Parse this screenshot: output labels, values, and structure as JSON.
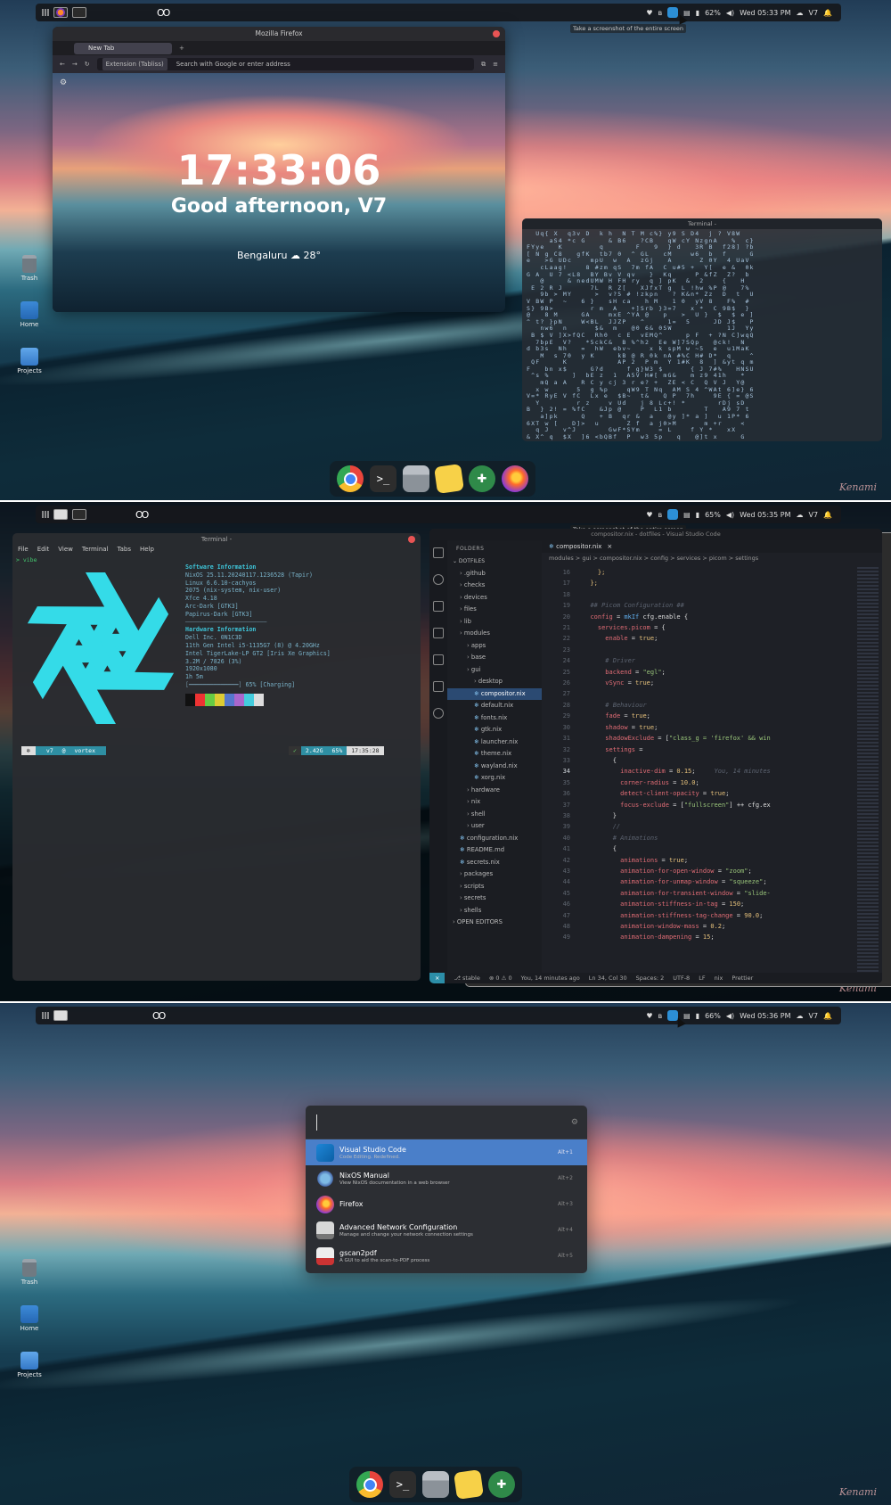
{
  "common": {
    "signature": "Kenami",
    "desktop_icons": [
      "Trash",
      "Home",
      "Projects"
    ],
    "ws_rings": "OO"
  },
  "panel1": {
    "topbar": {
      "battery": "62%",
      "datetime": "Wed 05:33 PM",
      "user": "V7",
      "tooltip": "Take a screenshot of the entire screen"
    },
    "firefox": {
      "window_title": "Mozilla Firefox",
      "tab_label": "New Tab",
      "extension_label": "Extension (Tabliss)",
      "url_placeholder": "Search with Google or enter address",
      "clock": "17:33:06",
      "greeting": "Good afternoon, V7",
      "weather_city": "Bengaluru",
      "weather_temp": "28°"
    },
    "matrix_terminal": {
      "title": "Terminal -"
    }
  },
  "panel2": {
    "topbar": {
      "battery": "65%",
      "datetime": "Wed 05:35 PM",
      "user": "V7",
      "tooltip": "Take a screenshot of the entire screen"
    },
    "terminal": {
      "title": "Terminal -",
      "menu": [
        "File",
        "Edit",
        "View",
        "Terminal",
        "Tabs",
        "Help"
      ],
      "prompt": "> vibe",
      "sw_header": "Software Information",
      "sw_lines": [
        "NixOS 25.11.20240117.1236528 (Tapir)",
        "Linux 6.6.10-cachyos",
        "2075 (nix-system, nix-user)",
        "Xfce 4.18",
        "Arc-Dark [GTK3]",
        "Papirus-Dark [GTK3]"
      ],
      "hw_header": "Hardware Information",
      "hw_lines": [
        "Dell Inc. 0N1C3D",
        "11th Gen Intel i5-1135G7 (8) @ 4.20GHz",
        "Intel TigerLake-LP GT2 [Iris Xe Graphics]",
        "3.2M / 7826 (3%)",
        "1920x1080",
        "1h 5m"
      ],
      "battery_line": "65% [Charging]",
      "pl_user": "v7",
      "pl_host": "vortex",
      "pl_mem": "2.42G",
      "pl_bat": "65%",
      "pl_time": "17:35:28"
    },
    "vscode": {
      "window_title": "compositor.nix - dotfiles - Visual Studio Code",
      "explorer_header": "FOLDERS",
      "root": "DOTFILES",
      "tree": [
        ".github",
        "checks",
        "devices",
        "files",
        "lib",
        "modules",
        "apps",
        "base",
        "gui",
        "desktop",
        "compositor.nix",
        "default.nix",
        "fonts.nix",
        "gtk.nix",
        "launcher.nix",
        "theme.nix",
        "wayland.nix",
        "xorg.nix",
        "hardware",
        "nix",
        "shell",
        "user",
        "configuration.nix",
        "README.md",
        "secrets.nix",
        "packages",
        "scripts",
        "secrets",
        "shells",
        "OPEN EDITORS"
      ],
      "tab": "compositor.nix",
      "breadcrumb": "modules > gui > compositor.nix > config > services > picom > settings",
      "line_numbers": [
        "16",
        "17",
        "18",
        "19",
        "20",
        "21",
        "22",
        "23",
        "24",
        "25",
        "26",
        "27",
        "28",
        "29",
        "30",
        "31",
        "32",
        "33",
        "34",
        "35",
        "36",
        "37",
        "38",
        "39",
        "40",
        "41",
        "42",
        "43",
        "44",
        "45",
        "46",
        "47",
        "48",
        "49"
      ],
      "blame": "You, 14 minutes",
      "status": {
        "branch": "stable",
        "errors": "0",
        "warnings": "0",
        "blame": "You, 14 minutes ago",
        "cursor": "Ln 34, Col 30",
        "spaces": "Spaces: 2",
        "encoding": "UTF-8",
        "eol": "LF",
        "lang": "nix",
        "formatter": "Prettier"
      }
    }
  },
  "panel3": {
    "topbar": {
      "battery": "66%",
      "datetime": "Wed 05:36 PM",
      "user": "V7"
    },
    "launcher": {
      "items": [
        {
          "name": "Visual Studio Code",
          "desc": "Code Editing. Redefined.",
          "key": "Alt+1"
        },
        {
          "name": "NixOS Manual",
          "desc": "View NixOS documentation in a web browser",
          "key": "Alt+2"
        },
        {
          "name": "Firefox",
          "desc": "",
          "key": "Alt+3"
        },
        {
          "name": "Advanced Network Configuration",
          "desc": "Manage and change your network connection settings",
          "key": "Alt+4"
        },
        {
          "name": "gscan2pdf",
          "desc": "A GUI to aid the scan-to-PDF process",
          "key": "Alt+5"
        }
      ]
    }
  },
  "colors": {
    "accent": "#4a7fc9",
    "screenshot_btn": "#2c8fd6",
    "nix_logo": "#34dbe8"
  }
}
